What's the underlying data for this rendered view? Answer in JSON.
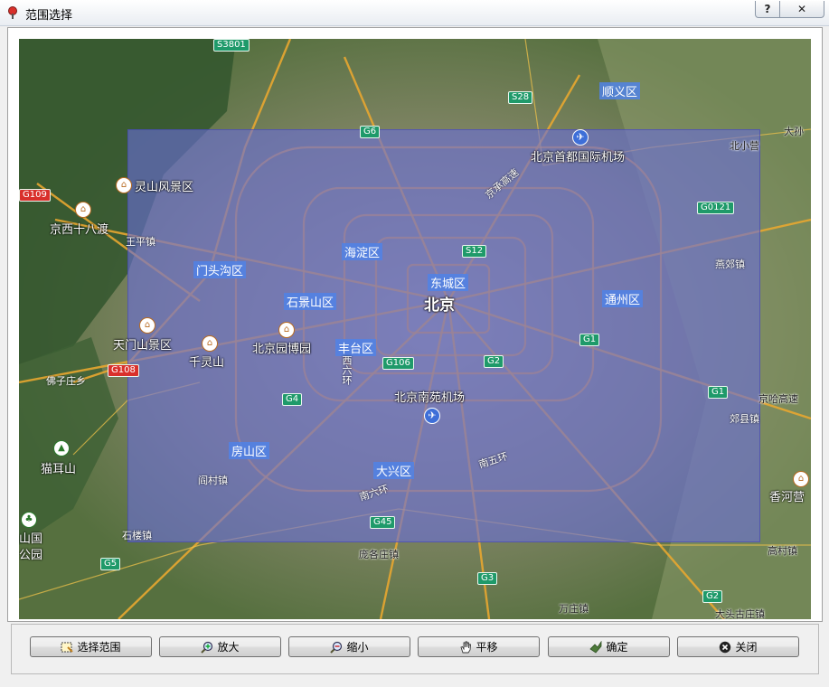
{
  "window": {
    "title": "范围选择",
    "help_label": "?",
    "close_label": "✕"
  },
  "map": {
    "selection_color": "#6a6ed7",
    "labels": {
      "shunyi": "顺义区",
      "airport_capital": "北京首都国际机场",
      "haidian": "海淀区",
      "dongcheng": "东城区",
      "beijing": "北京",
      "shijingshan": "石景山区",
      "tongzhou": "通州区",
      "mentougou": "门头沟区",
      "fengtai": "丰台区",
      "museum": "北京园博园",
      "airport_nanyuan": "北京南苑机场",
      "fangshan": "房山区",
      "daxing": "大兴区",
      "lingshan": "灵山风景区",
      "shibadu": "京西十八渡",
      "wangping": "王平镇",
      "tianmenshan": "天门山景区",
      "qianlingshan": "千灵山",
      "fozichuang": "佛子庄乡",
      "maoershan": "猫耳山",
      "shanguo": "山国",
      "gongyuan": "公园",
      "yancun": "阎村镇",
      "shilou": "石楼镇",
      "pangezhuang": "庞各庄镇",
      "wanzhuang": "万庄镇",
      "beixiaoying": "北小营",
      "yanjiao": "燕郊镇",
      "jiaxian": "郊县镇",
      "gaocun": "高村镇",
      "xiangheying": "香河营",
      "dasun": "大孙",
      "jinghaguo": "京哈高速",
      "datou": "大头古庄镇",
      "xiliuhuan": "西六环",
      "nanliuhuan": "南六环",
      "nanwuhuan": "南五环",
      "jingcheng": "京承高速"
    },
    "shields": {
      "s3801": "S3801",
      "s28": "S28",
      "g6": "G6",
      "s12": "S12",
      "g0121": "G0121",
      "g1a": "G1",
      "g1b": "G1",
      "g106": "G106",
      "g2a": "G2",
      "g2b": "G2",
      "g4": "G4",
      "g45": "G45",
      "g5": "G5",
      "g3": "G3",
      "g108": "G108",
      "g109": "G109"
    }
  },
  "toolbar": {
    "select_range": "选择范围",
    "zoom_in": "放大",
    "zoom_out": "缩小",
    "pan": "平移",
    "confirm": "确定",
    "close": "关闭"
  }
}
